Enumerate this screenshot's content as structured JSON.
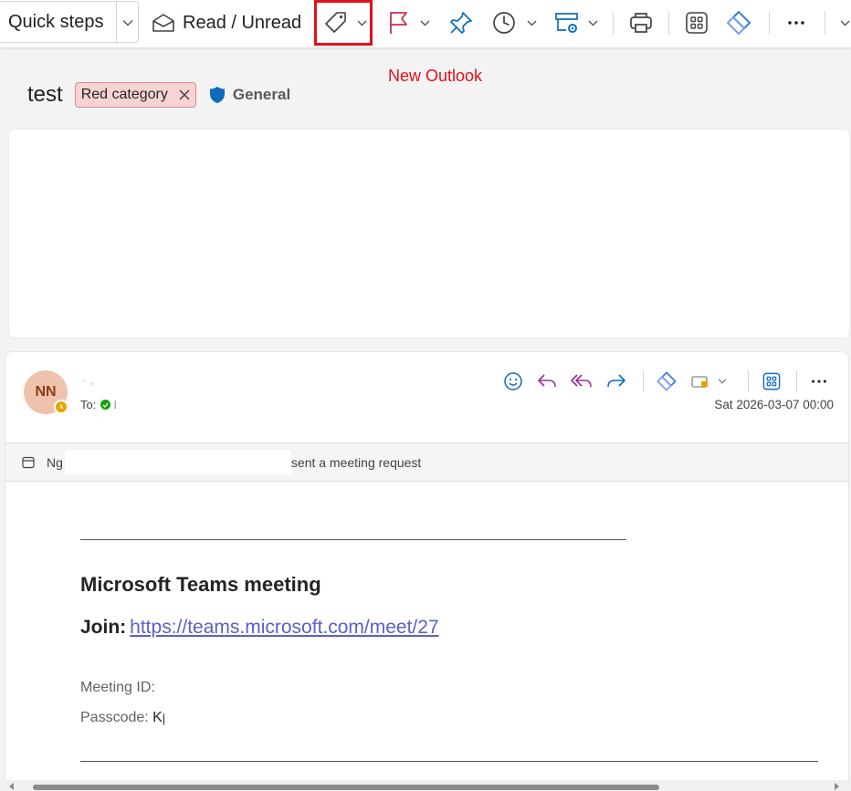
{
  "toolbar": {
    "quick_steps_label": "Quick steps",
    "read_unread_label": "Read / Unread"
  },
  "annotation": "New Outlook",
  "message": {
    "subject": "test",
    "category_label": "Red category",
    "sensitivity_label": "General",
    "avatar_initials": "NN",
    "sender_fragment": "·   ,",
    "to_label": "To:",
    "to_fragment": "I",
    "date": "Sat 2026-03-07 00:00",
    "meeting_sender_prefix": "Ng",
    "meeting_sent_text": "sent a meeting request",
    "separator_line": "________________________________________________________________________________",
    "teams_title": "Microsoft Teams meeting",
    "join_label": "Join:",
    "join_link": "https://teams.microsoft.com/meet/27",
    "meeting_id_label": "Meeting ID:",
    "passcode_label": "Passcode:",
    "passcode_value": "Kp"
  },
  "colors": {
    "accent_blue": "#0f6cbd",
    "flag_red": "#c4314b",
    "reply_purple": "#9c2a9c",
    "highlight_red": "#e3101a",
    "category_fill": "#f6d3d4",
    "link": "#5b5fc7"
  },
  "icons": [
    "chevron-down-icon",
    "envelope-open-icon",
    "tag-icon",
    "flag-icon",
    "pin-icon",
    "clock-icon",
    "rules-icon",
    "print-icon",
    "apps-icon",
    "loop-icon",
    "more-icon",
    "close-icon",
    "shield-icon",
    "emoji-icon",
    "reply-icon",
    "reply-all-icon",
    "forward-icon",
    "teams-icon",
    "calendar-icon"
  ]
}
